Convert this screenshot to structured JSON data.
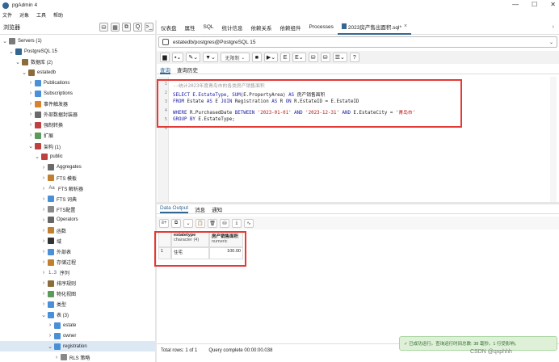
{
  "window": {
    "title": "pgAdmin 4",
    "controls": [
      "—",
      "☐",
      "✕"
    ]
  },
  "menu": [
    "文件",
    "对象",
    "工具",
    "帮助"
  ],
  "browser": {
    "title": "浏览器",
    "tools": [
      "⛁",
      "▦",
      "⧉",
      "Q",
      ">_"
    ]
  },
  "tree": [
    {
      "label": "Servers (1)",
      "twisty": "⌄",
      "icon": "servers-icon",
      "color": "#7a7a7a"
    },
    {
      "label": "PostgreSQL 15",
      "twisty": "⌄",
      "icon": "elephant-icon",
      "color": "#336791"
    },
    {
      "label": "数据库 (2)",
      "twisty": "⌄",
      "icon": "databases-icon",
      "color": "#8a6d3b"
    },
    {
      "label": "estatedb",
      "twisty": "⌄",
      "icon": "database-icon",
      "color": "#8a6d3b"
    },
    {
      "label": "Publications",
      "twisty": "›",
      "icon": "publication-icon",
      "color": "#4a90d9"
    },
    {
      "label": "Subscriptions",
      "twisty": "›",
      "icon": "subscription-icon",
      "color": "#4a90d9"
    },
    {
      "label": "事件触发器",
      "twisty": "›",
      "icon": "event-trigger-icon",
      "color": "#d9822b"
    },
    {
      "label": "外部数据封装器",
      "twisty": "›",
      "icon": "fdw-icon",
      "color": "#6a6a6a"
    },
    {
      "label": "强制转换",
      "twisty": "›",
      "icon": "cast-icon",
      "color": "#c04040"
    },
    {
      "label": "扩展",
      "twisty": "›",
      "icon": "extension-icon",
      "color": "#5a9a5a"
    },
    {
      "label": "架构 (1)",
      "twisty": "⌄",
      "icon": "schemas-icon",
      "color": "#c04040"
    },
    {
      "label": "public",
      "twisty": "⌄",
      "icon": "schema-icon",
      "color": "#c04040"
    },
    {
      "label": "Aggregates",
      "twisty": "›",
      "icon": "aggregate-icon",
      "color": "#6a6a6a"
    },
    {
      "label": "FTS 模板",
      "twisty": "›",
      "icon": "fts-template-icon",
      "color": "#c08030"
    },
    {
      "label": "FTS 解析器",
      "twisty": "›",
      "icon": "fts-parser-icon",
      "color": "#555555"
    },
    {
      "label": "FTS 词典",
      "twisty": "›",
      "icon": "fts-dictionary-icon",
      "color": "#4a90d9"
    },
    {
      "label": "FTS配置",
      "twisty": "›",
      "icon": "fts-config-icon",
      "color": "#888888"
    },
    {
      "label": "Operators",
      "twisty": "›",
      "icon": "operator-icon",
      "color": "#666666"
    },
    {
      "label": "函数",
      "twisty": "›",
      "icon": "function-icon",
      "color": "#c08030"
    },
    {
      "label": "域",
      "twisty": "›",
      "icon": "domain-icon",
      "color": "#333333"
    },
    {
      "label": "外部表",
      "twisty": "›",
      "icon": "foreign-table-icon",
      "color": "#4a90d9"
    },
    {
      "label": "存储过程",
      "twisty": "›",
      "icon": "procedure-icon",
      "color": "#c08030"
    },
    {
      "label": "序列",
      "twisty": "›",
      "icon": "sequence-icon",
      "color": "#336791"
    },
    {
      "label": "排序规则",
      "twisty": "›",
      "icon": "collation-icon",
      "color": "#8a6d3b"
    },
    {
      "label": "物化视图",
      "twisty": "›",
      "icon": "materialized-view-icon",
      "color": "#5a9a5a"
    },
    {
      "label": "类型",
      "twisty": "›",
      "icon": "type-icon",
      "color": "#4a90d9"
    },
    {
      "label": "表 (3)",
      "twisty": "⌄",
      "icon": "tables-icon",
      "color": "#4a90d9"
    },
    {
      "label": "estate",
      "twisty": "›",
      "icon": "table-icon",
      "color": "#4a90d9"
    },
    {
      "label": "owner",
      "twisty": "›",
      "icon": "table-icon",
      "color": "#4a90d9"
    },
    {
      "label": "registration",
      "twisty": "⌄",
      "icon": "table-icon",
      "color": "#4a90d9"
    },
    {
      "label": "RLS 策略",
      "twisty": "›",
      "icon": "rls-icon",
      "color": "#888888"
    }
  ],
  "tree_seq_label": "1..3",
  "tree_fts_parser_glyph": "Aa",
  "tabs": [
    {
      "label": "仪表盘"
    },
    {
      "label": "属性"
    },
    {
      "label": "SQL"
    },
    {
      "label": "统计信息"
    },
    {
      "label": "依赖关系"
    },
    {
      "label": "依赖组件"
    },
    {
      "label": "Processes"
    },
    {
      "label": "2023房产售出面积.sql*"
    }
  ],
  "connection": "estatedb/postgres@PostgreSQL 15",
  "toolbar": {
    "limit_label": "无限制"
  },
  "query_tabs": [
    "查询",
    "查询历史"
  ],
  "editor": {
    "lines": [
      "1",
      "2",
      "3",
      "4",
      "5",
      "6"
    ],
    "line1": "--统计2023年度青岛市的各类房产销售面积",
    "line2_a": "SELECT E.EstateType, ",
    "line2_b": "SUM",
    "line2_c": "(E.PropertyArea) ",
    "line2_d": "AS",
    "line2_e": " 房产销售面积",
    "line3_a": "FROM",
    "line3_b": " Estate ",
    "line3_c": "AS",
    "line3_d": " E ",
    "line3_e": "JOIN",
    "line3_f": " Registration ",
    "line3_g": "AS",
    "line3_h": " R ",
    "line3_i": "ON",
    "line3_j": " R.EstateID = E.EstateID",
    "line4_a": "WHERE",
    "line4_b": " R.PurchasedDate ",
    "line4_c": "BETWEEN",
    "line4_d": " ",
    "line4_e": "'2023-01-01'",
    "line4_f": " ",
    "line4_g": "AND",
    "line4_h": " ",
    "line4_i": "'2023-12-31'",
    "line4_j": " ",
    "line4_k": "AND",
    "line4_l": " E.EstateCity = ",
    "line4_m": "'青岛市'",
    "line5_a": "GROUP BY",
    "line5_b": " E.EstateType;"
  },
  "output_tabs": [
    "Data Output",
    "消息",
    "通知"
  ],
  "grid": {
    "columns": [
      {
        "name": "estatetype",
        "type": "character (4)"
      },
      {
        "name": "房产销售面积",
        "type": "numeric"
      }
    ],
    "rows": [
      {
        "num": "1",
        "cells": [
          "住宅",
          "100.00"
        ]
      }
    ]
  },
  "status": {
    "total_rows": "Total rows: 1 of 1",
    "query": "Query complete 00:00:00.038"
  },
  "toast": "✓ 已成功运行。查询运行时间总数: 38 毫秒。1 行受影响。",
  "watermark": "CSDN @qxphhh"
}
